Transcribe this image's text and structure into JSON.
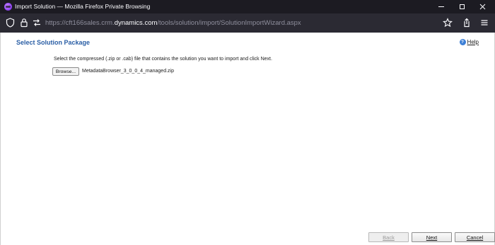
{
  "window": {
    "title": "Import Solution — Mozilla Firefox Private Browsing"
  },
  "addressbar": {
    "url_prefix": "https://cft166sales.crm.",
    "url_domain": "dynamics.com",
    "url_path": "/tools/solution/import/SolutionImportWizard.aspx"
  },
  "page": {
    "heading": "Select Solution Package",
    "help_label": "Help",
    "instruction": "Select the compressed (.zip or .cab) file that contains the solution you want to import and click Next.",
    "browse_label": "Browse...",
    "selected_file": "MetadataBrowser_3_0_0_4_managed.zip"
  },
  "footer": {
    "back_label": "Back",
    "next_label": "Next",
    "cancel_label": "Cancel"
  },
  "colors": {
    "titlebar": "#1c1b22",
    "urlbar": "#2b2a33",
    "heading": "#2a5ea5"
  }
}
